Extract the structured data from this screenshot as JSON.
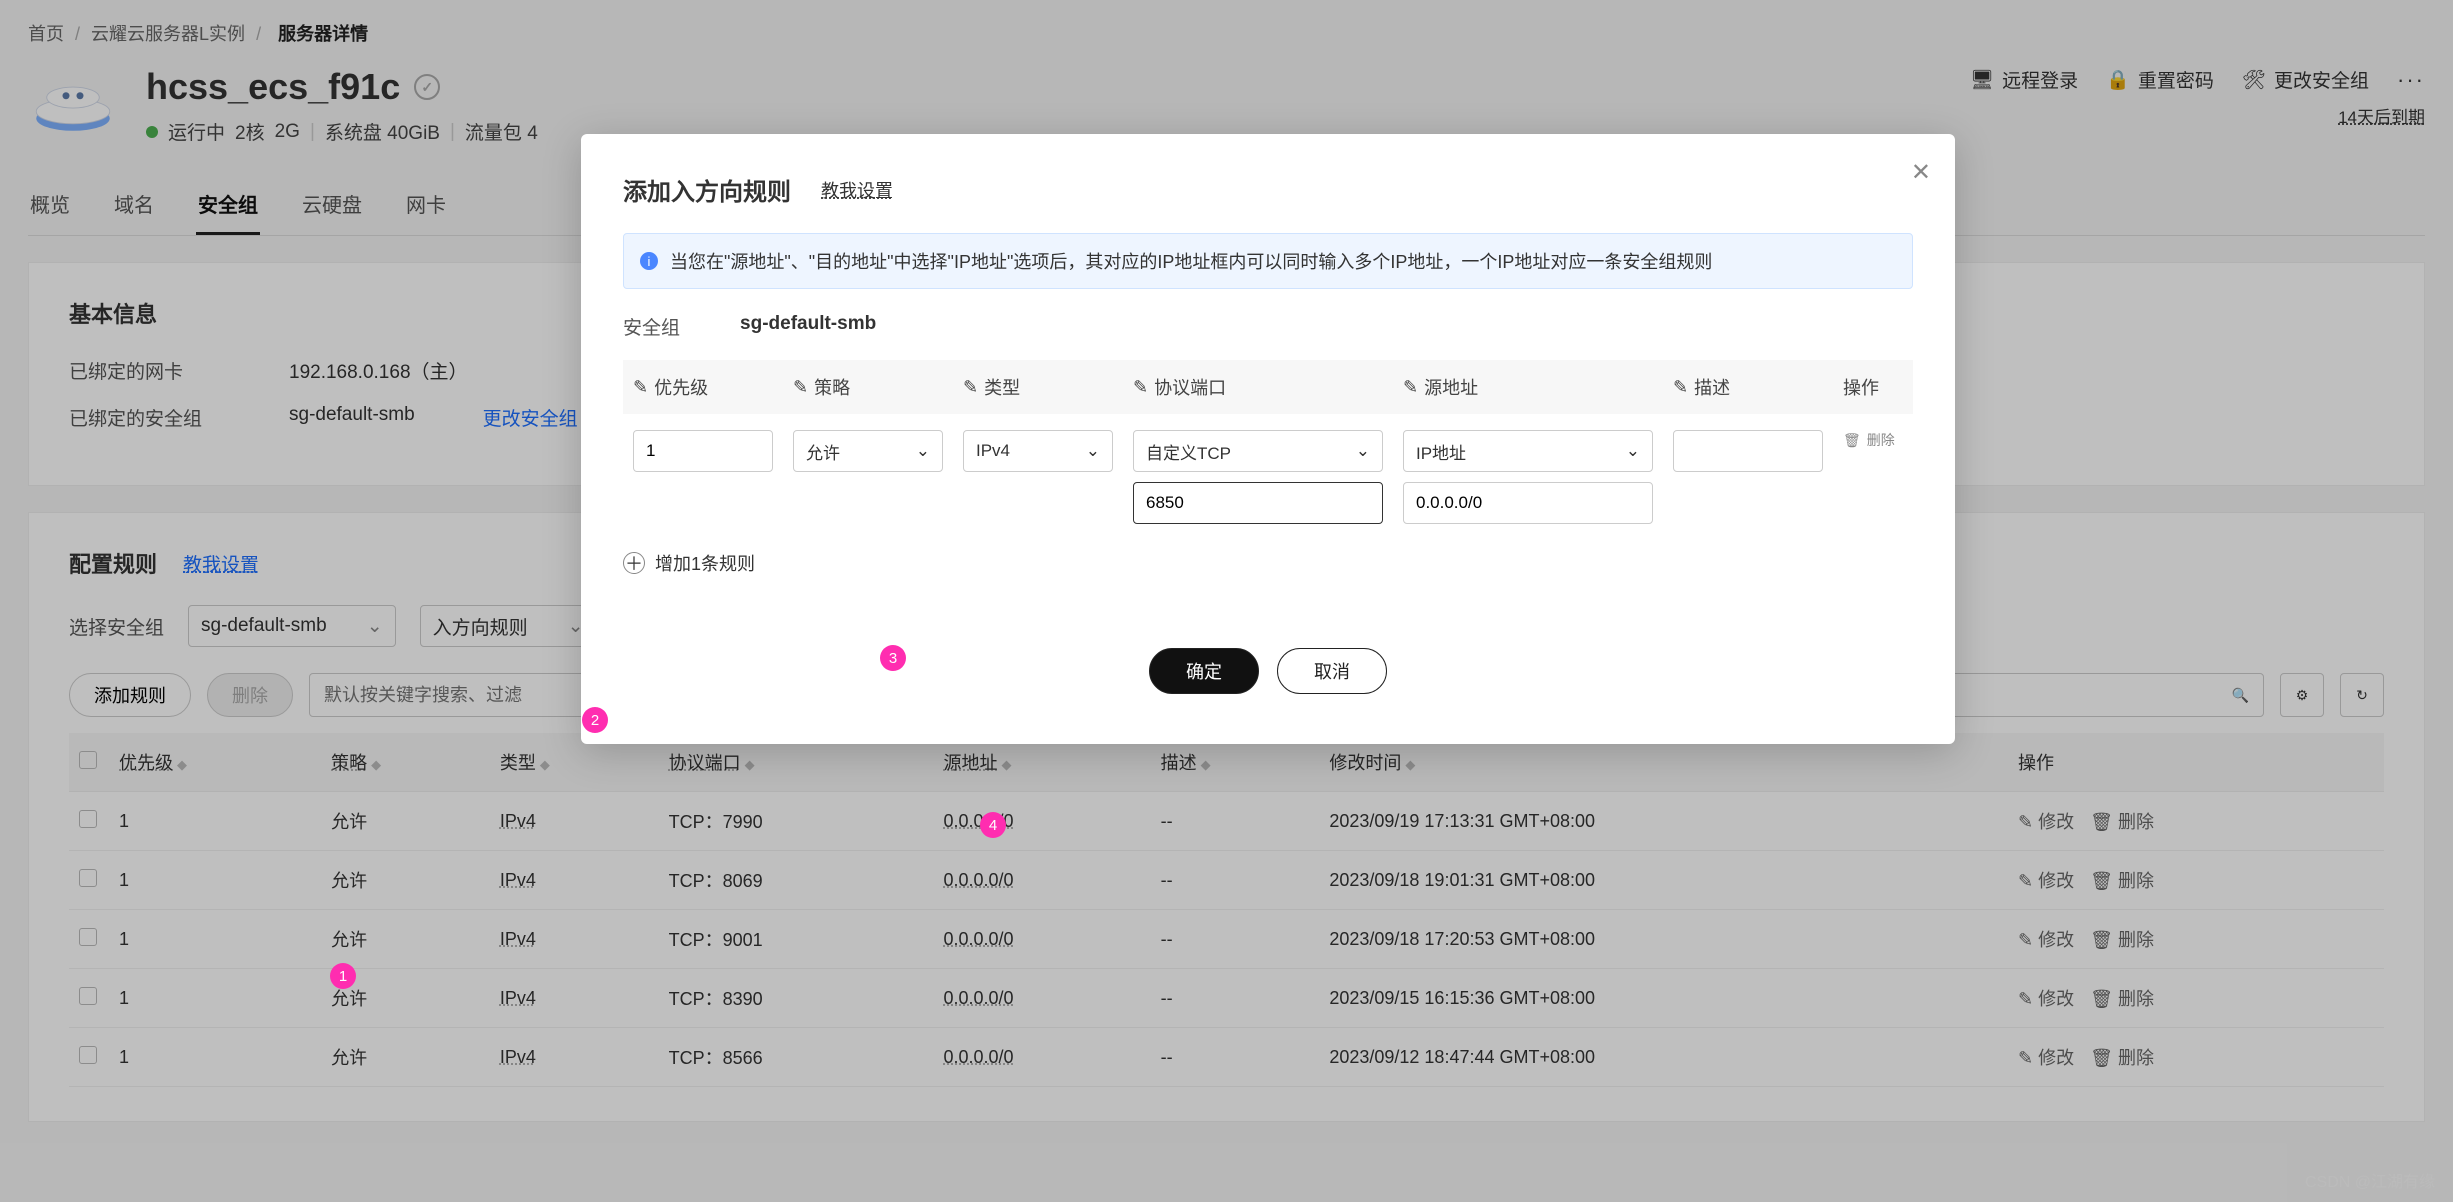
{
  "breadcrumb": {
    "home": "首页",
    "mid": "云耀云服务器L实例",
    "cur": "服务器详情",
    "sep": "/"
  },
  "server": {
    "name": "hcss_ecs_f91c",
    "status": "运行中",
    "spec1": "2核",
    "spec2": "2G",
    "sep": "|",
    "disk": "系统盘 40GiB",
    "flow": "流量包 4"
  },
  "header_actions": {
    "remote": "远程登录",
    "reset": "重置密码",
    "change": "更改安全组",
    "dots": "···"
  },
  "expire": "14天后到期",
  "tabs": {
    "overview": "概览",
    "domain": "域名",
    "sg": "安全组",
    "disk": "云硬盘",
    "nic": "网卡"
  },
  "basic": {
    "title": "基本信息",
    "nic_k": "已绑定的网卡",
    "nic_v": "192.168.0.168（主）",
    "sg_k": "已绑定的安全组",
    "sg_v": "sg-default-smb",
    "change": "更改安全组"
  },
  "rules": {
    "title": "配置规则",
    "hint": "教我设置",
    "select_lbl": "选择安全组",
    "sg_val": "sg-default-smb",
    "dir_val": "入方向规则",
    "add_btn": "添加规则",
    "del_btn": "删除",
    "search_ph": "默认按关键字搜索、过滤",
    "cols": {
      "prio": "优先级",
      "policy": "策略",
      "type": "类型",
      "port": "协议端口",
      "src": "源地址",
      "desc": "描述",
      "mtime": "修改时间",
      "op": "操作"
    },
    "rows": [
      {
        "prio": "1",
        "policy": "允许",
        "type": "IPv4",
        "port": "TCP：7990",
        "src": "0.0.0.0/0",
        "desc": "--",
        "mtime": "2023/09/19 17:13:31 GMT+08:00"
      },
      {
        "prio": "1",
        "policy": "允许",
        "type": "IPv4",
        "port": "TCP：8069",
        "src": "0.0.0.0/0",
        "desc": "--",
        "mtime": "2023/09/18 19:01:31 GMT+08:00"
      },
      {
        "prio": "1",
        "policy": "允许",
        "type": "IPv4",
        "port": "TCP：9001",
        "src": "0.0.0.0/0",
        "desc": "--",
        "mtime": "2023/09/18 17:20:53 GMT+08:00"
      },
      {
        "prio": "1",
        "policy": "允许",
        "type": "IPv4",
        "port": "TCP：8390",
        "src": "0.0.0.0/0",
        "desc": "--",
        "mtime": "2023/09/15 16:15:36 GMT+08:00"
      },
      {
        "prio": "1",
        "policy": "允许",
        "type": "IPv4",
        "port": "TCP：8566",
        "src": "0.0.0.0/0",
        "desc": "--",
        "mtime": "2023/09/12 18:47:44 GMT+08:00"
      }
    ],
    "row_act": {
      "edit": "修改",
      "del": "删除"
    }
  },
  "modal": {
    "title": "添加入方向规则",
    "hint": "教我设置",
    "notice": "当您在\"源地址\"、\"目的地址\"中选择\"IP地址\"选项后，其对应的IP地址框内可以同时输入多个IP地址，一个IP地址对应一条安全组规则",
    "sg_k": "安全组",
    "sg_v": "sg-default-smb",
    "cols": {
      "prio": "优先级",
      "policy": "策略",
      "type": "类型",
      "port": "协议端口",
      "src": "源地址",
      "desc": "描述",
      "op": "操作"
    },
    "form": {
      "prio": "1",
      "policy": "允许",
      "type": "IPv4",
      "proto": "自定义TCP",
      "port": "6850",
      "src_type": "IP地址",
      "src_val": "0.0.0.0/0",
      "desc": "",
      "del": "删除"
    },
    "add_more": "增加1条规则",
    "ok": "确定",
    "cancel": "取消"
  },
  "chevron": "⌄",
  "icons": {
    "search": "🔍",
    "refresh": "↻",
    "gear": "⚙",
    "trash": "🗑",
    "pen": "✎",
    "monitor": "🖥",
    "lock": "🔒",
    "wrench": "🛠",
    "info": "i",
    "plus": "＋"
  },
  "watermark": "CSDN @江湖有缘",
  "bubbles": {
    "b1": "1",
    "b2": "2",
    "b3": "3",
    "b4": "4"
  }
}
